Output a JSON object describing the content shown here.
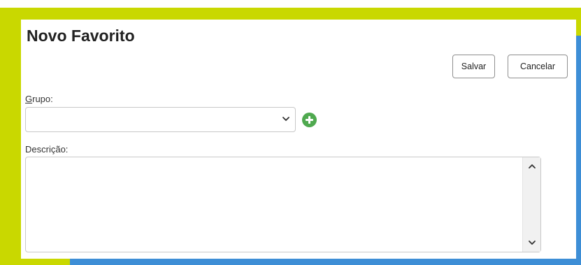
{
  "dialog": {
    "title": "Novo Favorito",
    "save_label": "Salvar",
    "cancel_label": "Cancelar"
  },
  "form": {
    "grupo_label": "Grupo:",
    "grupo_value": "",
    "add_group_icon": "plus-circle-icon",
    "descricao_label": "Descrição:",
    "descricao_value": ""
  },
  "colors": {
    "accent_lime": "#c9d800",
    "accent_blue": "#3d8ed6",
    "add_green": "#4fa94f"
  }
}
